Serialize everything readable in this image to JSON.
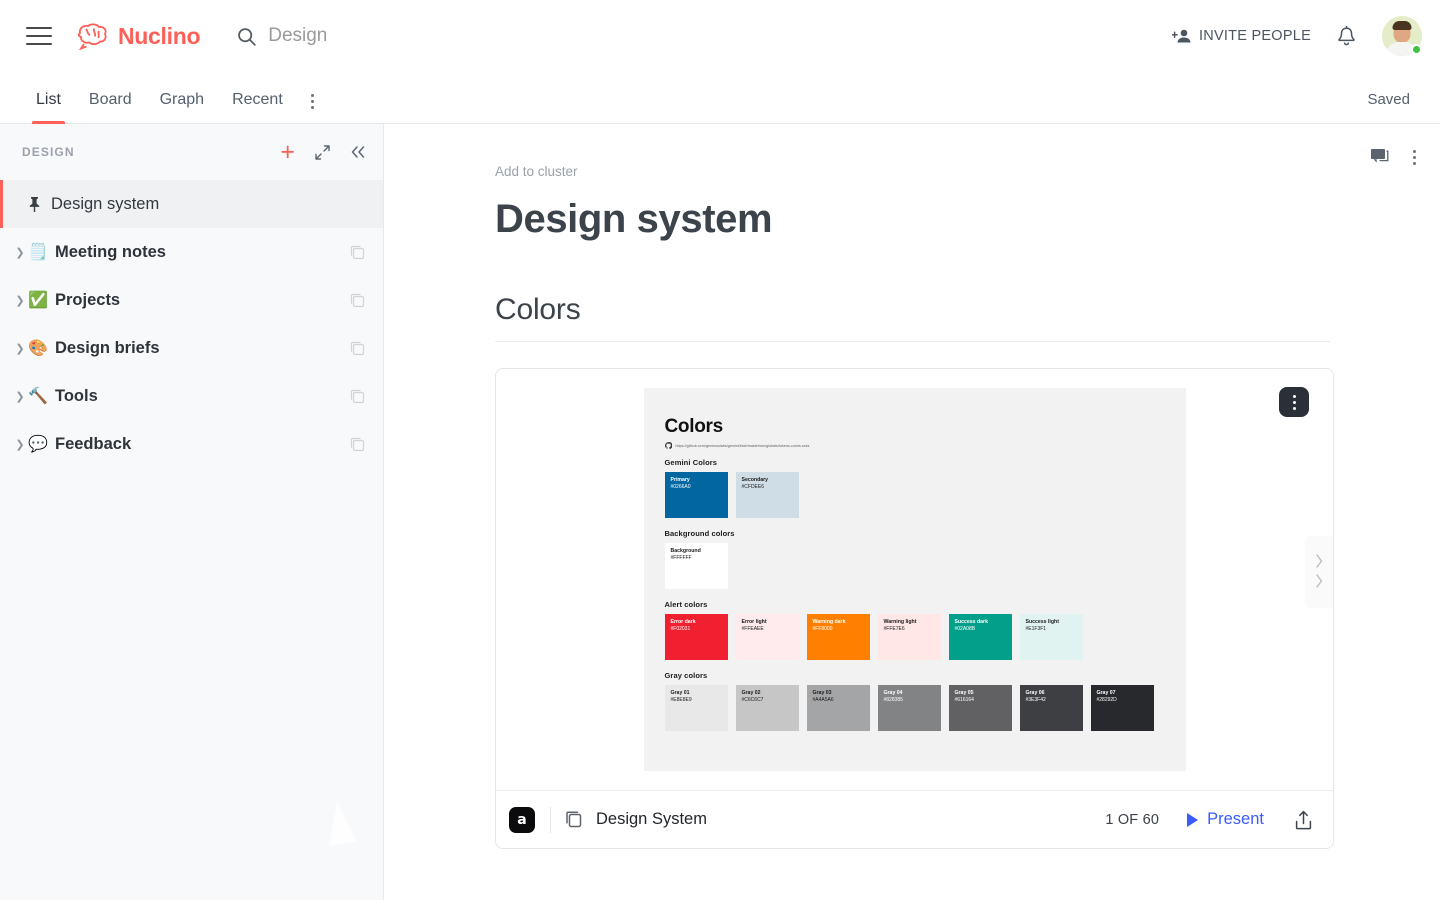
{
  "app": {
    "brand": "Nuclino",
    "search_placeholder": "Design",
    "invite_label": "INVITE PEOPLE",
    "saved_label": "Saved"
  },
  "tabs": [
    {
      "label": "List",
      "active": true
    },
    {
      "label": "Board",
      "active": false
    },
    {
      "label": "Graph",
      "active": false
    },
    {
      "label": "Recent",
      "active": false
    }
  ],
  "sidebar": {
    "title": "DESIGN",
    "items": [
      {
        "label": "Design system",
        "emoji": "",
        "icon": "pin-icon",
        "active": true,
        "expandable": false
      },
      {
        "label": "Meeting notes",
        "emoji": "🗒️",
        "active": false,
        "expandable": true
      },
      {
        "label": "Projects",
        "emoji": "✅",
        "active": false,
        "expandable": true
      },
      {
        "label": "Design briefs",
        "emoji": "🎨",
        "active": false,
        "expandable": true
      },
      {
        "label": "Tools",
        "emoji": "🔨",
        "active": false,
        "expandable": true
      },
      {
        "label": "Feedback",
        "emoji": "💬",
        "active": false,
        "expandable": true
      }
    ]
  },
  "document": {
    "add_to_cluster": "Add to cluster",
    "title": "Design system",
    "section_title": "Colors"
  },
  "embed": {
    "app_name": "Design System",
    "slide_counter": "1 OF 60",
    "present_label": "Present",
    "slide": {
      "heading": "Colors",
      "source_url": "https://github.com/geneuuslabs/gemini/blob/master/src/globals/tokens-colors.scss",
      "groups": [
        {
          "title": "Gemini Colors",
          "swatches": [
            {
              "name": "Primary",
              "hex": "#0266A0",
              "fg": "#FFFFFF"
            },
            {
              "name": "Secondary",
              "hex": "#CFDEE6",
              "fg": "#1A1A1A"
            }
          ]
        },
        {
          "title": "Background colors",
          "swatches": [
            {
              "name": "Background",
              "hex": "#FFFFFF",
              "fg": "#1A1A1A"
            }
          ]
        },
        {
          "title": "Alert colors",
          "swatches": [
            {
              "name": "Error dark",
              "hex": "#F02031",
              "fg": "#FFFFFF"
            },
            {
              "name": "Error light",
              "hex": "#FFEAEE",
              "fg": "#1A1A1A"
            },
            {
              "name": "Warning dark",
              "hex": "#FF8000",
              "fg": "#FFFFFF"
            },
            {
              "name": "Warning light",
              "hex": "#FFE7E6",
              "fg": "#1A1A1A"
            },
            {
              "name": "Success dark",
              "hex": "#02A08B",
              "fg": "#FFFFFF"
            },
            {
              "name": "Success light",
              "hex": "#E1F3F1",
              "fg": "#1A1A1A"
            }
          ]
        },
        {
          "title": "Gray colors",
          "swatches": [
            {
              "name": "Gray 01",
              "hex": "#E8E8E9",
              "fg": "#1A1A1A"
            },
            {
              "name": "Gray 02",
              "hex": "#C6C6C7",
              "fg": "#1A1A1A"
            },
            {
              "name": "Gray 03",
              "hex": "#A4A5A6",
              "fg": "#1A1A1A"
            },
            {
              "name": "Gray 04",
              "hex": "#828385",
              "fg": "#FFFFFF"
            },
            {
              "name": "Gray 05",
              "hex": "#616164",
              "fg": "#FFFFFF"
            },
            {
              "name": "Gray 06",
              "hex": "#3E3F42",
              "fg": "#FFFFFF"
            },
            {
              "name": "Gray 07",
              "hex": "#28292D",
              "fg": "#FFFFFF"
            }
          ]
        }
      ]
    }
  },
  "theme": {
    "accent": "#FC6058",
    "present_blue": "#3B5BFD",
    "sidebar_bg": "#F8F9FB"
  }
}
